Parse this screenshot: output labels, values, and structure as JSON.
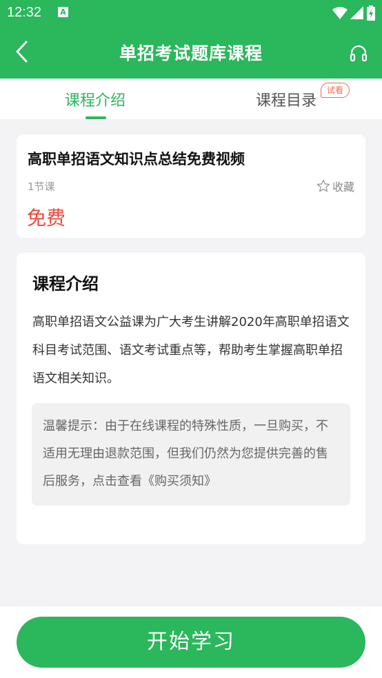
{
  "status_bar": {
    "time": "12:32",
    "notification_letter": "A",
    "icons": [
      "wifi-icon",
      "signal-icon",
      "battery-charging-icon"
    ]
  },
  "app_bar": {
    "title": "单招考试题库课程",
    "back_icon": "chevron-left-icon",
    "support_icon": "headset-icon"
  },
  "tabs": [
    {
      "label": "课程介绍",
      "active": true
    },
    {
      "label": "课程目录",
      "active": false,
      "badge": "试看"
    }
  ],
  "course": {
    "name": "高职单招语文知识点总结免费视频",
    "lesson_count": "1节课",
    "favorite_label": "收藏",
    "price": "免费"
  },
  "intro": {
    "heading": "课程介绍",
    "body": "高职单招语文公益课为广大考生讲解2020年高职单招语文科目考试范围、语文考试重点等，帮助考生掌握高职单招语文相关知识。",
    "notice": "温馨提示：由于在线课程的特殊性质，一旦购买，不适用无理由退款范围，但我们仍然为您提供完善的售后服务，点击查看《购买须知》"
  },
  "footer": {
    "start_button": "开始学习"
  },
  "colors": {
    "brand_green": "#2bb75c",
    "price_red": "#f0453a",
    "badge_orange": "#f06a4e"
  }
}
